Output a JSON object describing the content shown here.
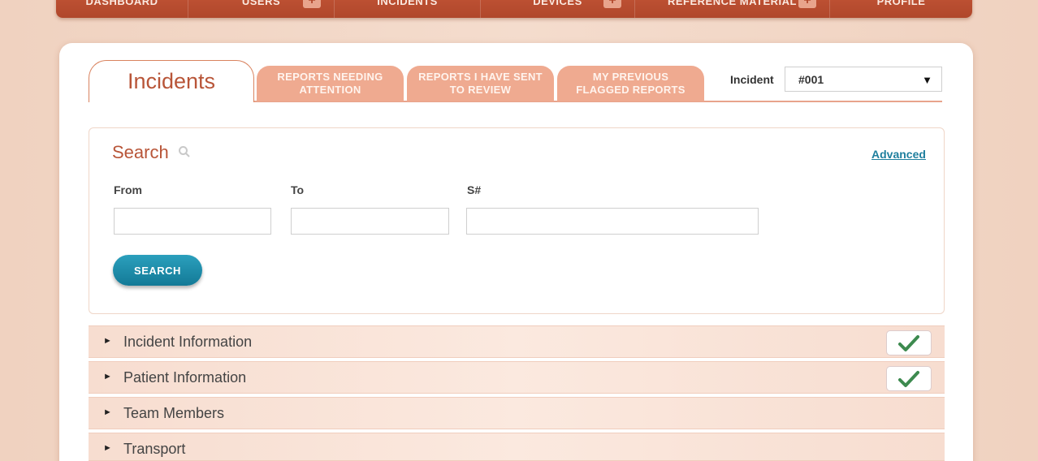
{
  "nav": {
    "items": [
      {
        "label": "DASHBOARD"
      },
      {
        "label": "USERS"
      },
      {
        "label": "INCIDENTS"
      },
      {
        "label": "DEVICES"
      },
      {
        "label": "REFERENCE MATERIAL"
      },
      {
        "label": "PROFILE"
      }
    ],
    "plus_symbol": "+"
  },
  "tabs": {
    "active": "Incidents",
    "items": [
      {
        "label": "REPORTS NEEDING ATTENTION"
      },
      {
        "label": "REPORTS I HAVE SENT TO REVIEW"
      },
      {
        "label": "MY PREVIOUS FLAGGED REPORTS"
      }
    ]
  },
  "incident_selector": {
    "label": "Incident",
    "value": "#001",
    "arrow": "▼"
  },
  "search": {
    "title": "Search",
    "advanced_link": "Advanced",
    "from_label": "From",
    "to_label": "To",
    "s_label": "S#",
    "from_value": "",
    "to_value": "",
    "s_value": "",
    "button_label": "SEARCH"
  },
  "sections": [
    {
      "label": "Incident Information",
      "completed": true
    },
    {
      "label": "Patient Information",
      "completed": true
    },
    {
      "label": "Team Members",
      "completed": false
    },
    {
      "label": "Transport",
      "completed": false
    }
  ],
  "expand_arrow": "►",
  "colors": {
    "nav": "#b54a2d",
    "accent": "#b85538",
    "tab": "#efaa90",
    "button": "#1b8aa8",
    "check": "#3d8a4f",
    "link": "#1f7f9e"
  },
  "icons": {
    "search": "search-icon",
    "check": "check-icon",
    "dropdown": "chevron-down-icon"
  }
}
